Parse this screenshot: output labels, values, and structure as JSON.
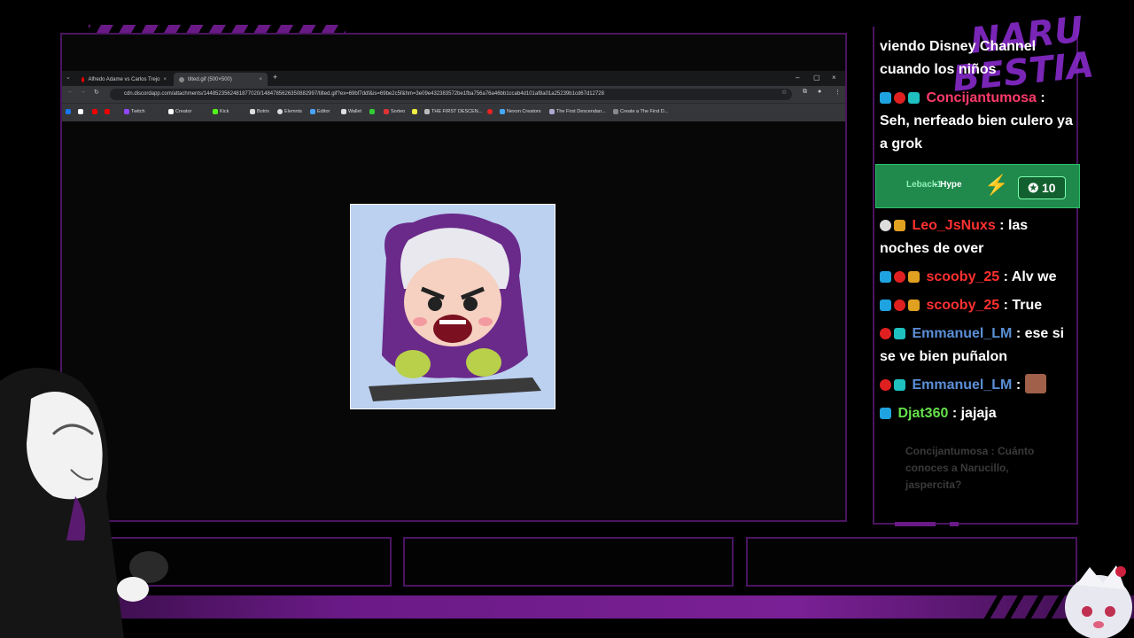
{
  "browser": {
    "tabs": [
      {
        "label": "Alfredo Adame vs Carlos Trejo",
        "active": false
      },
      {
        "label": "tilted.gif (500×500)",
        "active": true
      }
    ],
    "new_tab": "+",
    "url": "cdn.discordapp.com/attachments/1448523562481877020/1484785626350882997/tilted.gif?ex=69bf7ddf&is=69be2c5f&hm=3e09e432383572be1fba756a76a46bb1ccab4d101af8a01a25239b1cd67d12728",
    "bookmarks": [
      "Twitch",
      "Creator",
      "Kick",
      "Botrix",
      "Elemnts",
      "Editor",
      "Wallet",
      "Sorteo",
      "THE FIRST DESCEN...",
      "Nexon Creators",
      "The First Descendan...",
      "Create a The First D..."
    ],
    "window_controls": {
      "minimize": "–",
      "maximize": "▢",
      "close": "×"
    }
  },
  "chat": {
    "messages": [
      {
        "user": "",
        "text": "viendo Disney Channel cuando los niños",
        "color": "#ffffff"
      },
      {
        "user": "Concijantumosa",
        "text": "Seh, nerfeado bien culero ya a grok",
        "color": "#ff3b6b"
      },
      {
        "user": "Leo_JsNuxs",
        "text": "las noches de over",
        "color": "#ff3030"
      },
      {
        "user": "scooby_25",
        "text": "Alv we",
        "color": "#ff3030"
      },
      {
        "user": "scooby_25",
        "text": "True",
        "color": "#ff3030"
      },
      {
        "user": "Emmanuel_LM",
        "text": "ese si se ve bien puñalon",
        "color": "#5b8fd6"
      },
      {
        "user": "Emmanuel_LM",
        "text": "",
        "color": "#5b8fd6"
      },
      {
        "user": "Djat360",
        "text": "jajaja",
        "color": "#66e04a"
      }
    ],
    "hype": {
      "user": "Leback1",
      "label": "- Hype",
      "count": "10"
    },
    "faded_message": "Concijantumosa : Cuánto conoces a Narucillo, jaspercita?"
  },
  "logo": {
    "line1": "NARU",
    "line2": "BESTIA"
  },
  "colors": {
    "accent": "#6a1a86",
    "hype_bg": "#1f8a4c"
  }
}
